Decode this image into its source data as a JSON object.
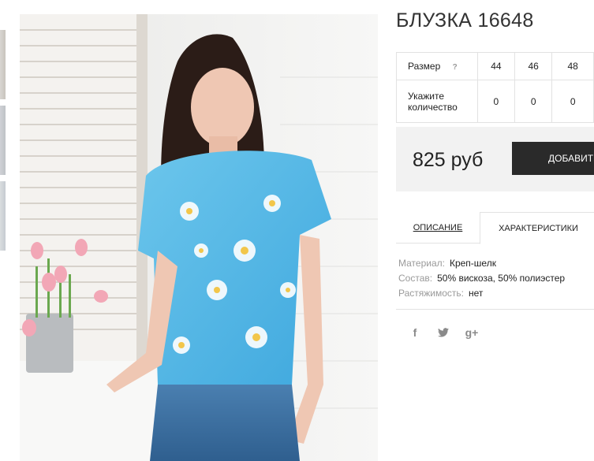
{
  "product": {
    "title": "БЛУЗКА 16648",
    "sizes_label": "Размер",
    "help_mark": "?",
    "qty_label_line1": "Укажите",
    "qty_label_line2": "количество",
    "sizes": [
      "44",
      "46",
      "48"
    ],
    "quantities": [
      "0",
      "0",
      "0"
    ],
    "price": "825 руб",
    "buy_label": "ДОБАВИТЬ В КОРЗИНУ"
  },
  "tabs": [
    {
      "label": "ОПИСАНИЕ",
      "active": false
    },
    {
      "label": "ХАРАКТЕРИСТИКИ",
      "active": true
    }
  ],
  "characteristics": [
    {
      "key": "Материал:",
      "value": "Креп-шелк"
    },
    {
      "key": "Состав:",
      "value": "50% вискоза, 50% полиэстер"
    },
    {
      "key": "Растяжимость:",
      "value": "нет"
    }
  ],
  "social": [
    {
      "icon": "facebook-icon",
      "glyph": "f"
    },
    {
      "icon": "twitter-icon",
      "glyph": "t"
    },
    {
      "icon": "google-plus-icon",
      "glyph": "g+"
    }
  ],
  "colors": {
    "accent_button": "#2a2a2a",
    "price_box": "#f2f2f2",
    "blouse": "#5cc0e8"
  }
}
